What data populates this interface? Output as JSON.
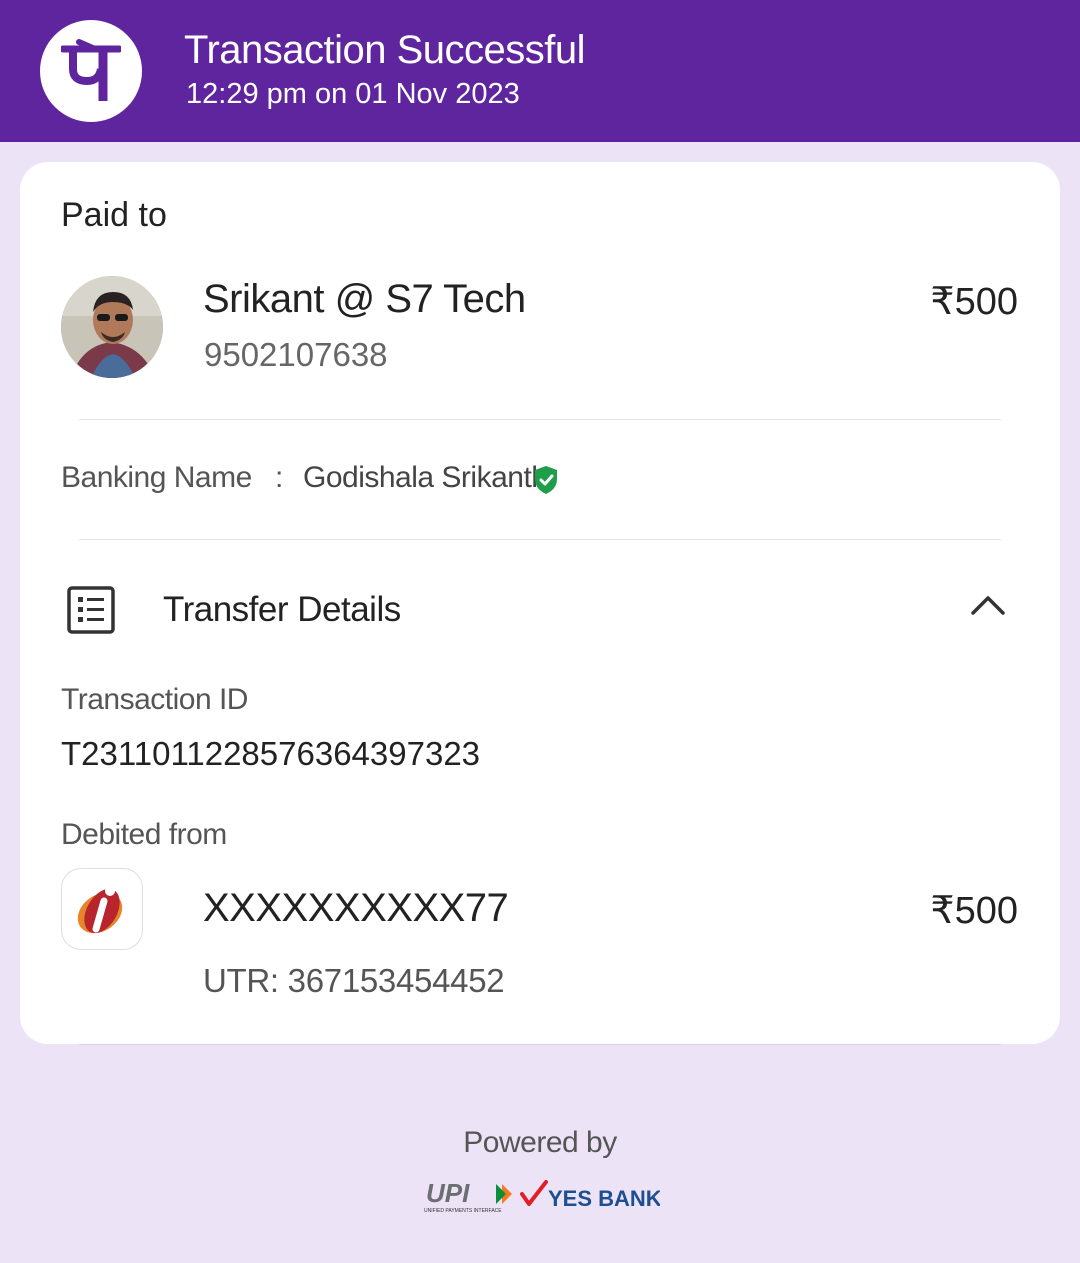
{
  "header": {
    "title": "Transaction Successful",
    "datetime": "12:29 pm on 01 Nov 2023",
    "logo_glyph": "पे",
    "background_color": "#5f259f"
  },
  "card": {
    "paid_to_label": "Paid to",
    "payee": {
      "name": "Srikant @ S7 Tech",
      "phone": "9502107638",
      "amount": "₹500"
    },
    "banking": {
      "label": "Banking Name",
      "separator": ":",
      "value": "Godishala Srikanth",
      "verified_icon": "shield-check-icon"
    },
    "transfer_details": {
      "title": "Transfer Details",
      "icon": "list-document-icon",
      "toggle_icon": "chevron-up-icon",
      "transaction_id_label": "Transaction ID",
      "transaction_id": "T2311011228576364397323",
      "debited_from_label": "Debited from",
      "account": "XXXXXXXXXX77",
      "amount": "₹500",
      "utr": "UTR: 367153454452"
    }
  },
  "footer": {
    "powered_by": "Powered by",
    "upi_text": "UPI",
    "upi_subtext": "UNIFIED PAYMENTS INTERFACE",
    "partner_bank": "YES BANK"
  },
  "colors": {
    "accent": "#5f259f",
    "page_bg": "#ede3f6",
    "verified_green": "#1e9e4a"
  }
}
